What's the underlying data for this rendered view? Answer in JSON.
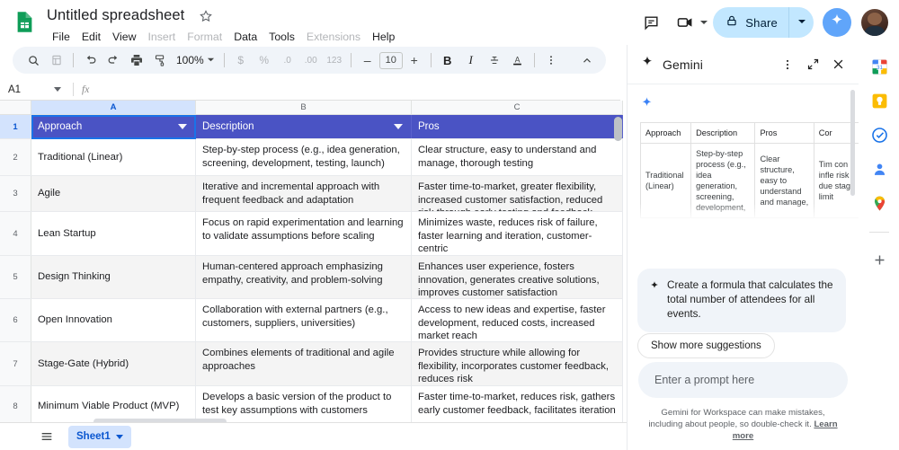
{
  "app": {
    "logo_icon": "google-sheets-icon",
    "doc_title": "Untitled spreadsheet",
    "star_icon": "star-outline-icon",
    "menus": [
      {
        "label": "File",
        "disabled": false
      },
      {
        "label": "Edit",
        "disabled": false
      },
      {
        "label": "View",
        "disabled": false
      },
      {
        "label": "Insert",
        "disabled": true
      },
      {
        "label": "Format",
        "disabled": true
      },
      {
        "label": "Data",
        "disabled": false
      },
      {
        "label": "Tools",
        "disabled": false
      },
      {
        "label": "Extensions",
        "disabled": true
      },
      {
        "label": "Help",
        "disabled": false
      }
    ]
  },
  "header_right": {
    "comment_icon": "comment-icon",
    "meet_icon": "video-camera-icon",
    "meet_caret_icon": "chevron-down-icon",
    "share_lock_icon": "lock-icon",
    "share_label": "Share",
    "share_caret_icon": "chevron-down-icon",
    "gemini_icon": "gemini-sparkle-icon",
    "avatar": "user-avatar",
    "share_bg": "#c2e7ff",
    "gemini_bg": "#60a5fa"
  },
  "toolbar": {
    "items": [
      {
        "name": "search-icon",
        "glyph": "search",
        "dim": false
      },
      {
        "name": "menus-icon",
        "glyph": "menus",
        "dim": true
      },
      {
        "name": "undo-icon",
        "glyph": "undo",
        "dim": false
      },
      {
        "name": "redo-icon",
        "glyph": "redo",
        "dim": false
      },
      {
        "name": "print-icon",
        "glyph": "print",
        "dim": false
      },
      {
        "name": "paint-format-icon",
        "glyph": "paint",
        "dim": false
      }
    ],
    "zoom_value": "100%",
    "zoom_caret_icon": "chevron-down-icon",
    "format_items": [
      {
        "name": "currency-format-button",
        "label": "$",
        "dim": true
      },
      {
        "name": "percent-format-button",
        "label": "%",
        "dim": true
      },
      {
        "name": "decrease-decimal-button",
        "label": ".0",
        "dim": true
      },
      {
        "name": "increase-decimal-button",
        "label": ".00",
        "dim": true
      },
      {
        "name": "more-formats-button",
        "label": "123",
        "dim": true
      }
    ],
    "font_decrease": "–",
    "font_size": "10",
    "font_increase": "+",
    "text_items": [
      {
        "name": "bold-button",
        "label": "B"
      },
      {
        "name": "italic-button",
        "label": "I"
      },
      {
        "name": "strikethrough-button",
        "label": "S"
      },
      {
        "name": "text-color-button",
        "label": "A"
      }
    ],
    "more_icon": "more-vertical-icon",
    "collapse_icon": "chevron-up-icon"
  },
  "formula_bar": {
    "name_box_value": "A1",
    "name_box_caret": "chevron-down-icon",
    "fx_label": "fx",
    "formula_value": ""
  },
  "grid": {
    "columns": [
      "A",
      "B",
      "C"
    ],
    "selected_column": "A",
    "selected_cell": "A1",
    "header_row_color": "#4a53c4",
    "filter_caret_icon": "filter-dropdown-icon",
    "header_cells": [
      "Approach",
      "Description",
      "Pros"
    ],
    "rows": [
      {
        "number": "2",
        "approach": "Traditional (Linear)",
        "description": "Step-by-step process (e.g., idea generation, screening, development, testing, launch)",
        "pros": "Clear structure, easy to understand and manage, thorough testing"
      },
      {
        "number": "3",
        "approach": "Agile",
        "description": "Iterative and incremental approach with frequent feedback and adaptation",
        "pros": "Faster time-to-market, greater flexibility, increased customer satisfaction, reduced risk through early testing and feedback"
      },
      {
        "number": "4",
        "approach": "Lean Startup",
        "description": "Focus on rapid experimentation and learning to validate assumptions before scaling",
        "pros": "Minimizes waste, reduces risk of failure, faster learning and iteration, customer-centric"
      },
      {
        "number": "5",
        "approach": "Design Thinking",
        "description": "Human-centered approach emphasizing empathy, creativity, and problem-solving",
        "pros": "Enhances user experience, fosters innovation, generates creative solutions, improves customer satisfaction"
      },
      {
        "number": "6",
        "approach": "Open Innovation",
        "description": "Collaboration with external partners (e.g., customers, suppliers, universities)",
        "pros": "Access to new ideas and expertise, faster development, reduced costs, increased market reach"
      },
      {
        "number": "7",
        "approach": "Stage-Gate (Hybrid)",
        "description": "Combines elements of traditional and agile approaches",
        "pros": "Provides structure while allowing for flexibility, incorporates customer feedback, reduces risk"
      },
      {
        "number": "8",
        "approach": "Minimum Viable Product (MVP)",
        "description": "Develops a basic version of the product to test key assumptions with customers",
        "pros": "Faster time-to-market, reduces risk, gathers early customer feedback, facilitates iteration"
      }
    ],
    "header_row_number": "1"
  },
  "sheet_bar": {
    "all_sheets_icon": "hamburger-menu-icon",
    "tab_label": "Sheet1",
    "tab_caret_icon": "chevron-down-icon",
    "expand_icon": "chevron-right-icon"
  },
  "gemini": {
    "sparkle_icon": "gemini-sparkle-icon",
    "title": "Gemini",
    "more_icon": "more-vertical-icon",
    "expand_icon": "expand-diagonal-icon",
    "close_icon": "close-icon",
    "response_spark_icon": "gemini-sparkle-icon",
    "preview_table": {
      "headers": [
        "Approach",
        "Description",
        "Pros",
        "Cor"
      ],
      "rows": [
        [
          "Traditional (Linear)",
          "Step-by-step process (e.g., idea generation, screening, development,",
          "Clear structure, easy to understand and manage,",
          "Tim con infle risk due stag limit"
        ]
      ]
    },
    "suggestion": {
      "spark_icon": "gemini-sparkle-icon",
      "text": "Create a formula that calculates the total number of attendees for all events."
    },
    "show_more_label": "Show more suggestions",
    "prompt_placeholder": "Enter a prompt here",
    "disclaimer_text": "Gemini for Workspace can make mistakes, including about people, so double-check it.",
    "disclaimer_link": "Learn more"
  },
  "rail": {
    "items": [
      {
        "name": "google-calendar-icon",
        "label": "Calendar"
      },
      {
        "name": "google-keep-icon",
        "label": "Keep"
      },
      {
        "name": "google-tasks-icon",
        "label": "Tasks"
      },
      {
        "name": "google-contacts-icon",
        "label": "Contacts"
      },
      {
        "name": "google-maps-icon",
        "label": "Maps"
      }
    ],
    "add_icon": "plus-icon"
  }
}
